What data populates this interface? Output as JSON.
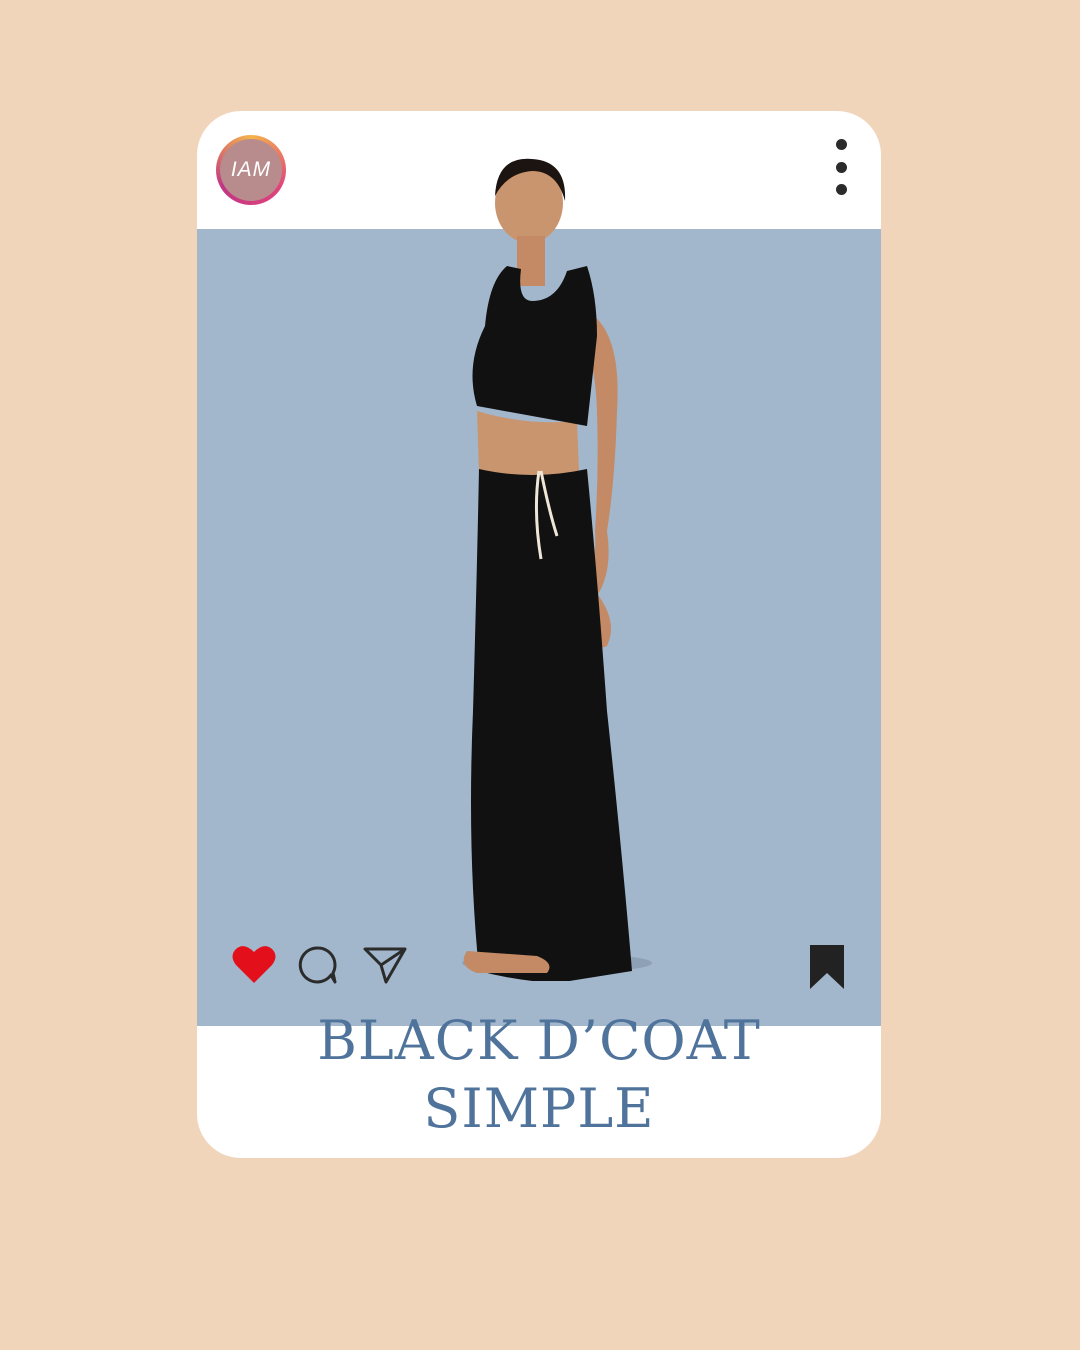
{
  "post": {
    "avatar_text": "IAM",
    "caption_line1": "BLACK D’COAT",
    "caption_line2": "SIMPLE"
  },
  "icons": {
    "avatar": "brand-avatar",
    "more": "more-vertical-icon",
    "like": "heart-icon",
    "comment": "comment-icon",
    "share": "send-icon",
    "save": "bookmark-icon"
  },
  "colors": {
    "page_background": "#f1d5bb",
    "card_background": "#ffffff",
    "photo_background": "#a2b7cc",
    "caption_text": "#4f739a",
    "like_heart": "#e3101c",
    "outfit": "#111111"
  }
}
